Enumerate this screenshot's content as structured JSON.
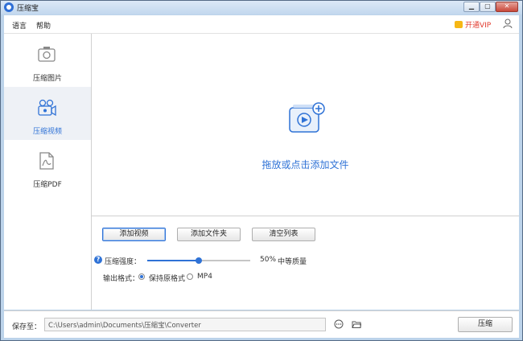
{
  "window": {
    "title": "压缩宝"
  },
  "menu": {
    "language": "语言",
    "help": "帮助",
    "vip": "开通VIP"
  },
  "sidebar": {
    "items": [
      {
        "label": "压缩图片",
        "icon": "image-compress-icon",
        "active": false
      },
      {
        "label": "压缩视频",
        "icon": "video-compress-icon",
        "active": true
      },
      {
        "label": "压缩PDF",
        "icon": "pdf-compress-icon",
        "active": false
      }
    ]
  },
  "dropzone": {
    "text": "拖放或点击添加文件"
  },
  "actions": {
    "add_video": "添加视频",
    "add_folder": "添加文件夹",
    "clear_list": "清空列表"
  },
  "compression": {
    "label": "压缩强度：",
    "percent": 50,
    "percent_text": "50%",
    "quality_text": "中等质量"
  },
  "output": {
    "label": "输出格式：",
    "options": [
      "保持原格式",
      "MP4"
    ],
    "selected": "保持原格式"
  },
  "save": {
    "label": "保存至：",
    "path": "C:\\Users\\admin\\Documents\\压缩宝\\Converter"
  },
  "compress_button": "压缩",
  "colors": {
    "accent": "#2f72d6",
    "vip": "#e23a2e",
    "titlebar": "#c2d7ee"
  }
}
